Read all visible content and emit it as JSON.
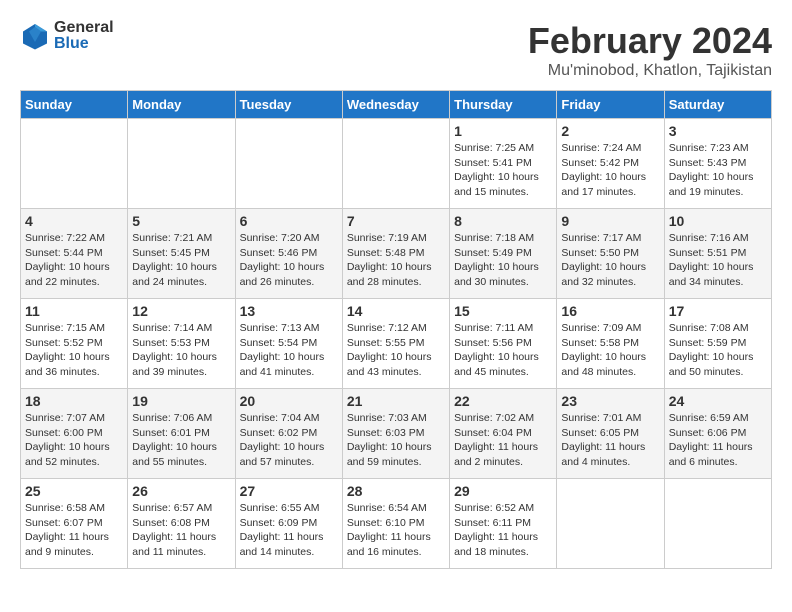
{
  "header": {
    "logo_general": "General",
    "logo_blue": "Blue",
    "month_title": "February 2024",
    "location": "Mu'minobod, Khatlon, Tajikistan"
  },
  "days_of_week": [
    "Sunday",
    "Monday",
    "Tuesday",
    "Wednesday",
    "Thursday",
    "Friday",
    "Saturday"
  ],
  "weeks": [
    [
      {
        "day": "",
        "info": ""
      },
      {
        "day": "",
        "info": ""
      },
      {
        "day": "",
        "info": ""
      },
      {
        "day": "",
        "info": ""
      },
      {
        "day": "1",
        "info": "Sunrise: 7:25 AM\nSunset: 5:41 PM\nDaylight: 10 hours\nand 15 minutes."
      },
      {
        "day": "2",
        "info": "Sunrise: 7:24 AM\nSunset: 5:42 PM\nDaylight: 10 hours\nand 17 minutes."
      },
      {
        "day": "3",
        "info": "Sunrise: 7:23 AM\nSunset: 5:43 PM\nDaylight: 10 hours\nand 19 minutes."
      }
    ],
    [
      {
        "day": "4",
        "info": "Sunrise: 7:22 AM\nSunset: 5:44 PM\nDaylight: 10 hours\nand 22 minutes."
      },
      {
        "day": "5",
        "info": "Sunrise: 7:21 AM\nSunset: 5:45 PM\nDaylight: 10 hours\nand 24 minutes."
      },
      {
        "day": "6",
        "info": "Sunrise: 7:20 AM\nSunset: 5:46 PM\nDaylight: 10 hours\nand 26 minutes."
      },
      {
        "day": "7",
        "info": "Sunrise: 7:19 AM\nSunset: 5:48 PM\nDaylight: 10 hours\nand 28 minutes."
      },
      {
        "day": "8",
        "info": "Sunrise: 7:18 AM\nSunset: 5:49 PM\nDaylight: 10 hours\nand 30 minutes."
      },
      {
        "day": "9",
        "info": "Sunrise: 7:17 AM\nSunset: 5:50 PM\nDaylight: 10 hours\nand 32 minutes."
      },
      {
        "day": "10",
        "info": "Sunrise: 7:16 AM\nSunset: 5:51 PM\nDaylight: 10 hours\nand 34 minutes."
      }
    ],
    [
      {
        "day": "11",
        "info": "Sunrise: 7:15 AM\nSunset: 5:52 PM\nDaylight: 10 hours\nand 36 minutes."
      },
      {
        "day": "12",
        "info": "Sunrise: 7:14 AM\nSunset: 5:53 PM\nDaylight: 10 hours\nand 39 minutes."
      },
      {
        "day": "13",
        "info": "Sunrise: 7:13 AM\nSunset: 5:54 PM\nDaylight: 10 hours\nand 41 minutes."
      },
      {
        "day": "14",
        "info": "Sunrise: 7:12 AM\nSunset: 5:55 PM\nDaylight: 10 hours\nand 43 minutes."
      },
      {
        "day": "15",
        "info": "Sunrise: 7:11 AM\nSunset: 5:56 PM\nDaylight: 10 hours\nand 45 minutes."
      },
      {
        "day": "16",
        "info": "Sunrise: 7:09 AM\nSunset: 5:58 PM\nDaylight: 10 hours\nand 48 minutes."
      },
      {
        "day": "17",
        "info": "Sunrise: 7:08 AM\nSunset: 5:59 PM\nDaylight: 10 hours\nand 50 minutes."
      }
    ],
    [
      {
        "day": "18",
        "info": "Sunrise: 7:07 AM\nSunset: 6:00 PM\nDaylight: 10 hours\nand 52 minutes."
      },
      {
        "day": "19",
        "info": "Sunrise: 7:06 AM\nSunset: 6:01 PM\nDaylight: 10 hours\nand 55 minutes."
      },
      {
        "day": "20",
        "info": "Sunrise: 7:04 AM\nSunset: 6:02 PM\nDaylight: 10 hours\nand 57 minutes."
      },
      {
        "day": "21",
        "info": "Sunrise: 7:03 AM\nSunset: 6:03 PM\nDaylight: 10 hours\nand 59 minutes."
      },
      {
        "day": "22",
        "info": "Sunrise: 7:02 AM\nSunset: 6:04 PM\nDaylight: 11 hours\nand 2 minutes."
      },
      {
        "day": "23",
        "info": "Sunrise: 7:01 AM\nSunset: 6:05 PM\nDaylight: 11 hours\nand 4 minutes."
      },
      {
        "day": "24",
        "info": "Sunrise: 6:59 AM\nSunset: 6:06 PM\nDaylight: 11 hours\nand 6 minutes."
      }
    ],
    [
      {
        "day": "25",
        "info": "Sunrise: 6:58 AM\nSunset: 6:07 PM\nDaylight: 11 hours\nand 9 minutes."
      },
      {
        "day": "26",
        "info": "Sunrise: 6:57 AM\nSunset: 6:08 PM\nDaylight: 11 hours\nand 11 minutes."
      },
      {
        "day": "27",
        "info": "Sunrise: 6:55 AM\nSunset: 6:09 PM\nDaylight: 11 hours\nand 14 minutes."
      },
      {
        "day": "28",
        "info": "Sunrise: 6:54 AM\nSunset: 6:10 PM\nDaylight: 11 hours\nand 16 minutes."
      },
      {
        "day": "29",
        "info": "Sunrise: 6:52 AM\nSunset: 6:11 PM\nDaylight: 11 hours\nand 18 minutes."
      },
      {
        "day": "",
        "info": ""
      },
      {
        "day": "",
        "info": ""
      }
    ]
  ]
}
